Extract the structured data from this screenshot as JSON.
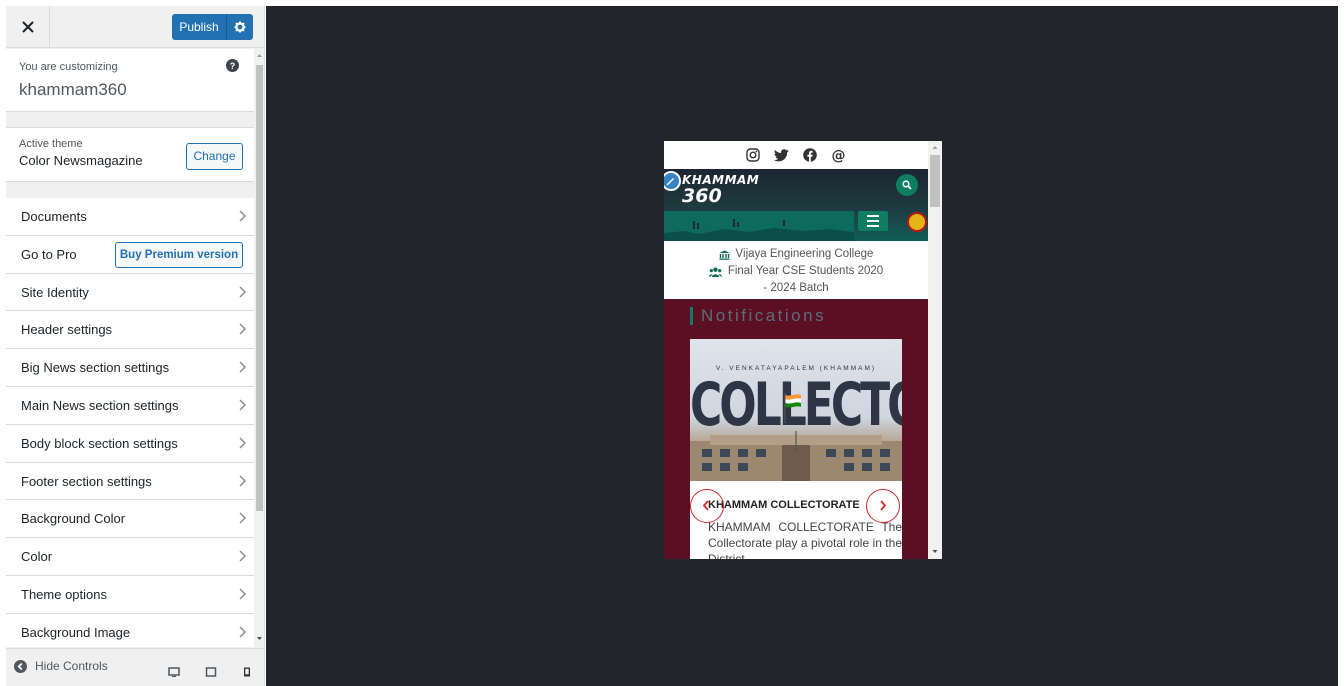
{
  "topbar": {
    "publish_label": "Publish"
  },
  "customizing": {
    "label": "You are customizing",
    "site_name": "khammam360"
  },
  "active_theme": {
    "label": "Active theme",
    "name": "Color Newsmagazine",
    "change_label": "Change"
  },
  "menu": [
    {
      "label": "Documents"
    },
    {
      "label": "Go to Pro",
      "button": "Buy Premium version"
    },
    {
      "label": "Site Identity"
    },
    {
      "label": "Header settings"
    },
    {
      "label": "Big News section settings"
    },
    {
      "label": "Main News section settings"
    },
    {
      "label": "Body block section settings"
    },
    {
      "label": "Footer section settings"
    },
    {
      "label": "Background Color"
    },
    {
      "label": "Color"
    },
    {
      "label": "Theme options"
    },
    {
      "label": "Background Image"
    }
  ],
  "footer": {
    "hide_controls": "Hide Controls"
  },
  "preview": {
    "logo_line1": "KHAMMAM",
    "logo_line2": "360",
    "college_line1": "Vijaya Engineering College",
    "college_line2": "Final Year CSE Students 2020",
    "college_line3": "- 2024 Batch",
    "notifications_title": "Notifications",
    "card": {
      "image_subtitle": "V. VENKATAYAPALEM (KHAMMAM)",
      "image_title": "COLLECTORATE",
      "title": "KHAMMAM COLLECTORATE",
      "text": "KHAMMAM COLLECTORATE The Collectorate play a pivotal role in the District"
    }
  },
  "colors": {
    "publish": "#2271b1",
    "preview_bg": "#22252b",
    "notifications_bg": "#5b0f22",
    "accent_green": "#0e7d62",
    "slider_arrow": "#d52a2a"
  },
  "icons": [
    "close-icon",
    "gear-icon",
    "help-icon",
    "chevron-right-icon",
    "instagram-icon",
    "twitter-icon",
    "facebook-icon",
    "at-icon",
    "search-icon",
    "menu-icon",
    "pencil-icon",
    "college-icon",
    "group-icon",
    "desktop-icon",
    "tablet-icon",
    "mobile-icon"
  ]
}
